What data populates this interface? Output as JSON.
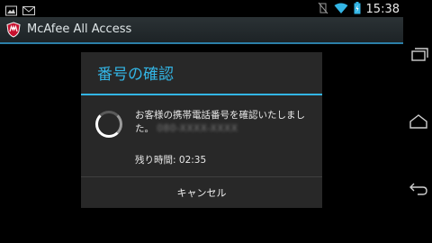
{
  "status_bar": {
    "clock": "15:38",
    "left_icons": [
      "gallery-notification-icon",
      "mail-notification-icon"
    ],
    "right_icons": [
      "vibrate-mute-icon",
      "wifi-icon",
      "battery-icon"
    ]
  },
  "action_bar": {
    "app_icon": "mcafee-shield-icon",
    "title": "McAfee All Access"
  },
  "dialog": {
    "title": "番号の確認",
    "message": "お客様の携帯電話番号を確認いたしました。",
    "phone_number_obscured": "080-XXXX-XXXX",
    "remaining_time_label": "残り時間:",
    "remaining_time_value": "02:35",
    "cancel_label": "キャンセル",
    "accent_color": "#33b5e5"
  },
  "nav_bar": {
    "buttons": [
      "recent-apps-icon",
      "home-icon",
      "back-icon"
    ]
  }
}
